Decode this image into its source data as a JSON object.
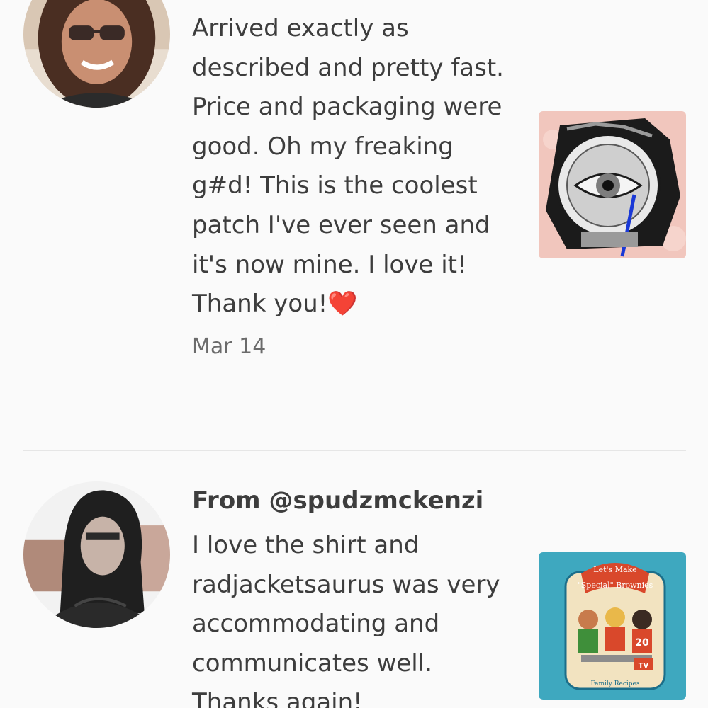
{
  "reviews": [
    {
      "author": "",
      "text": "Arrived exactly as described and pretty fast. Price and packaging were good. Oh my freaking g#d! This is the coolest patch I've ever seen and it's now mine. I love it! Thank you!",
      "emoji": "❤️",
      "date": "Mar 14",
      "avatar_icon": "reviewer-avatar-photo",
      "thumb_icon": "eye-patch-product-photo"
    },
    {
      "author": "From @spudzmckenzi",
      "text": "I love the shirt and radjacketsaurus was very accommodating and communicates well. Thanks again!",
      "avatar_icon": "reviewer-avatar-photo",
      "thumb_icon": "brownies-shirt-product-photo"
    }
  ],
  "thumb2": {
    "line1": "Let's Make",
    "line2": "\"Special\" Brownies",
    "number": "20",
    "badge": "TV",
    "footer": "Family Recipes"
  }
}
